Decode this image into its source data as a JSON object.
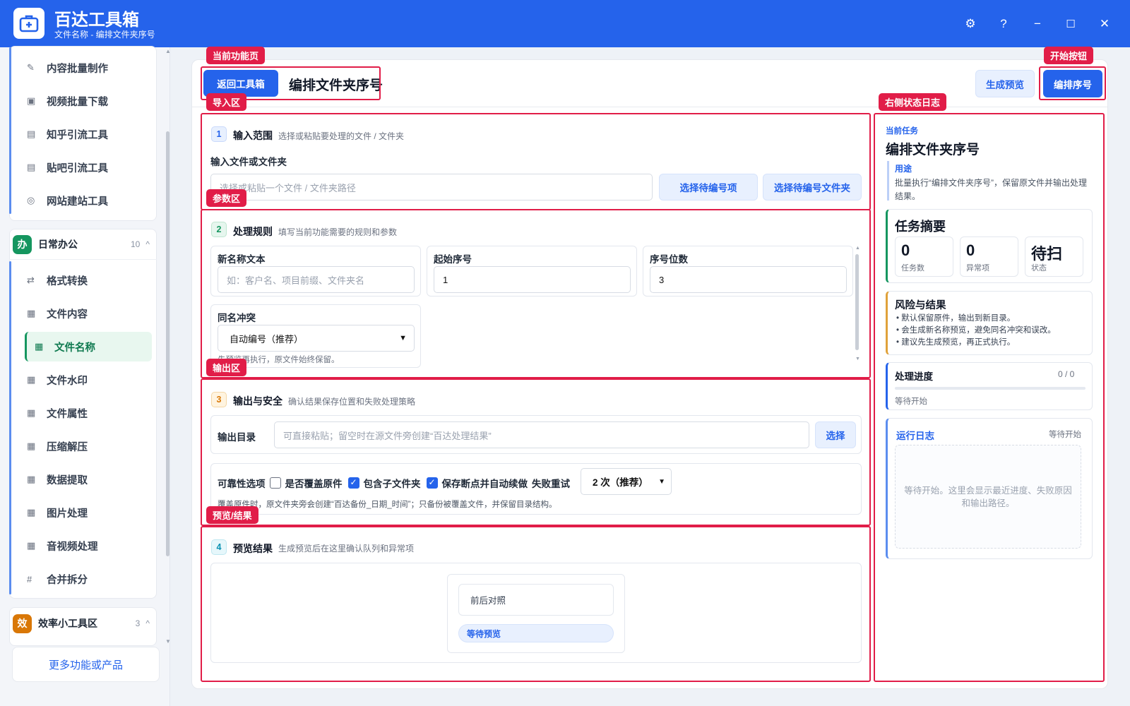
{
  "app": {
    "title": "百达工具箱",
    "subtitle": "文件名称 - 编排文件夹序号"
  },
  "window_controls": {
    "settings": "⚙",
    "help": "?",
    "minimize": "−",
    "maximize": "☐",
    "close": "✕"
  },
  "sidebar": {
    "top_items": [
      {
        "label": "内容批量制作",
        "icon": "✎"
      },
      {
        "label": "视频批量下载",
        "icon": "▣"
      },
      {
        "label": "知乎引流工具",
        "icon": "▤"
      },
      {
        "label": "贴吧引流工具",
        "icon": "▤"
      },
      {
        "label": "网站建站工具",
        "icon": "◎"
      }
    ],
    "group_office": {
      "badge": "办",
      "name": "日常办公",
      "count": "10",
      "caret": "^"
    },
    "office_items": [
      {
        "label": "格式转换",
        "icon": "⇄"
      },
      {
        "label": "文件内容",
        "icon": "▦"
      },
      {
        "label": "文件名称",
        "icon": "▦"
      },
      {
        "label": "文件水印",
        "icon": "▦"
      },
      {
        "label": "文件属性",
        "icon": "▦"
      },
      {
        "label": "压缩解压",
        "icon": "▦"
      },
      {
        "label": "数据提取",
        "icon": "▦"
      },
      {
        "label": "图片处理",
        "icon": "▦"
      },
      {
        "label": "音视频处理",
        "icon": "▦"
      },
      {
        "label": "合并拆分",
        "icon": "#"
      }
    ],
    "group_efficiency": {
      "badge": "效",
      "name": "效率小工具区",
      "count": "3",
      "caret": "^"
    },
    "more_link": "更多功能或产品"
  },
  "header": {
    "back_button": "返回工具箱",
    "page_title": "编排文件夹序号",
    "preview_button": "生成预览",
    "start_button": "编排序号"
  },
  "annotations": {
    "current_page": "当前功能页",
    "start_button": "开始按钮",
    "import": "导入区",
    "params": "参数区",
    "output": "输出区",
    "preview": "预览/结果",
    "right_log": "右侧状态日志"
  },
  "section1": {
    "num": "1",
    "title": "输入范围",
    "desc": "选择或粘贴要处理的文件 / 文件夹",
    "field_label": "输入文件或文件夹",
    "placeholder": "选择或粘贴一个文件 / 文件夹路径",
    "btn_items": "选择待编号项",
    "btn_folder": "选择待编号文件夹"
  },
  "section2": {
    "num": "2",
    "title": "处理规则",
    "desc": "填写当前功能需要的规则和参数",
    "new_name_label": "新名称文本",
    "new_name_placeholder": "如：客户名、项目前缀、文件夹名",
    "start_seq_label": "起始序号",
    "start_seq_value": "1",
    "digits_label": "序号位数",
    "digits_value": "3",
    "conflict_label": "同名冲突",
    "conflict_value": "自动编号（推荐）",
    "note": "先预览再执行，原文件始终保留。"
  },
  "section3": {
    "num": "3",
    "title": "输出与安全",
    "desc": "确认结果保存位置和失败处理策略",
    "output_dir_label": "输出目录",
    "output_dir_placeholder": "可直接粘贴；留空时在源文件旁创建“百达处理结果”",
    "choose_button": "选择",
    "reliability_label": "可靠性选项",
    "overwrite_label": "是否覆盖原件",
    "subfolder_label": "包含子文件夹",
    "resume_label": "保存断点并自动续做",
    "retry_label": "失败重试",
    "retry_value": "2 次（推荐）",
    "note": "覆盖原件时，原文件夹旁会创建“百达备份_日期_时间”；只备份被覆盖文件，并保留目录结构。"
  },
  "section4": {
    "num": "4",
    "title": "预览结果",
    "desc": "生成预览后在这里确认队列和异常项",
    "compare_label": "前后对照",
    "waiting_badge": "等待预览"
  },
  "right_panel": {
    "current_task_label": "当前任务",
    "current_task": "编排文件夹序号",
    "usage_label": "用途",
    "usage_text": "批量执行“编排文件夹序号”，保留原文件并输出处理结果。",
    "summary_title": "任务摘要",
    "stats": [
      {
        "value": "0",
        "label": "任务数"
      },
      {
        "value": "0",
        "label": "异常项"
      },
      {
        "value": "待扫",
        "label": "状态"
      }
    ],
    "risk_title": "风险与结果",
    "risk_items": [
      "默认保留原件，输出到新目录。",
      "会生成新名称预览，避免同名冲突和误改。",
      "建议先生成预览，再正式执行。"
    ],
    "progress_title": "处理进度",
    "progress_count": "0 / 0",
    "progress_fraction": 0,
    "progress_status": "等待开始",
    "log_title": "运行日志",
    "log_status": "等待开始",
    "log_placeholder": "等待开始。这里会显示最近进度、失败原因和输出路径。"
  },
  "colors": {
    "brand": "#2563eb",
    "annotation": "#e11d48",
    "active_green": "#15965f",
    "office_badge": "#15965f",
    "efficiency_badge": "#d97706"
  }
}
